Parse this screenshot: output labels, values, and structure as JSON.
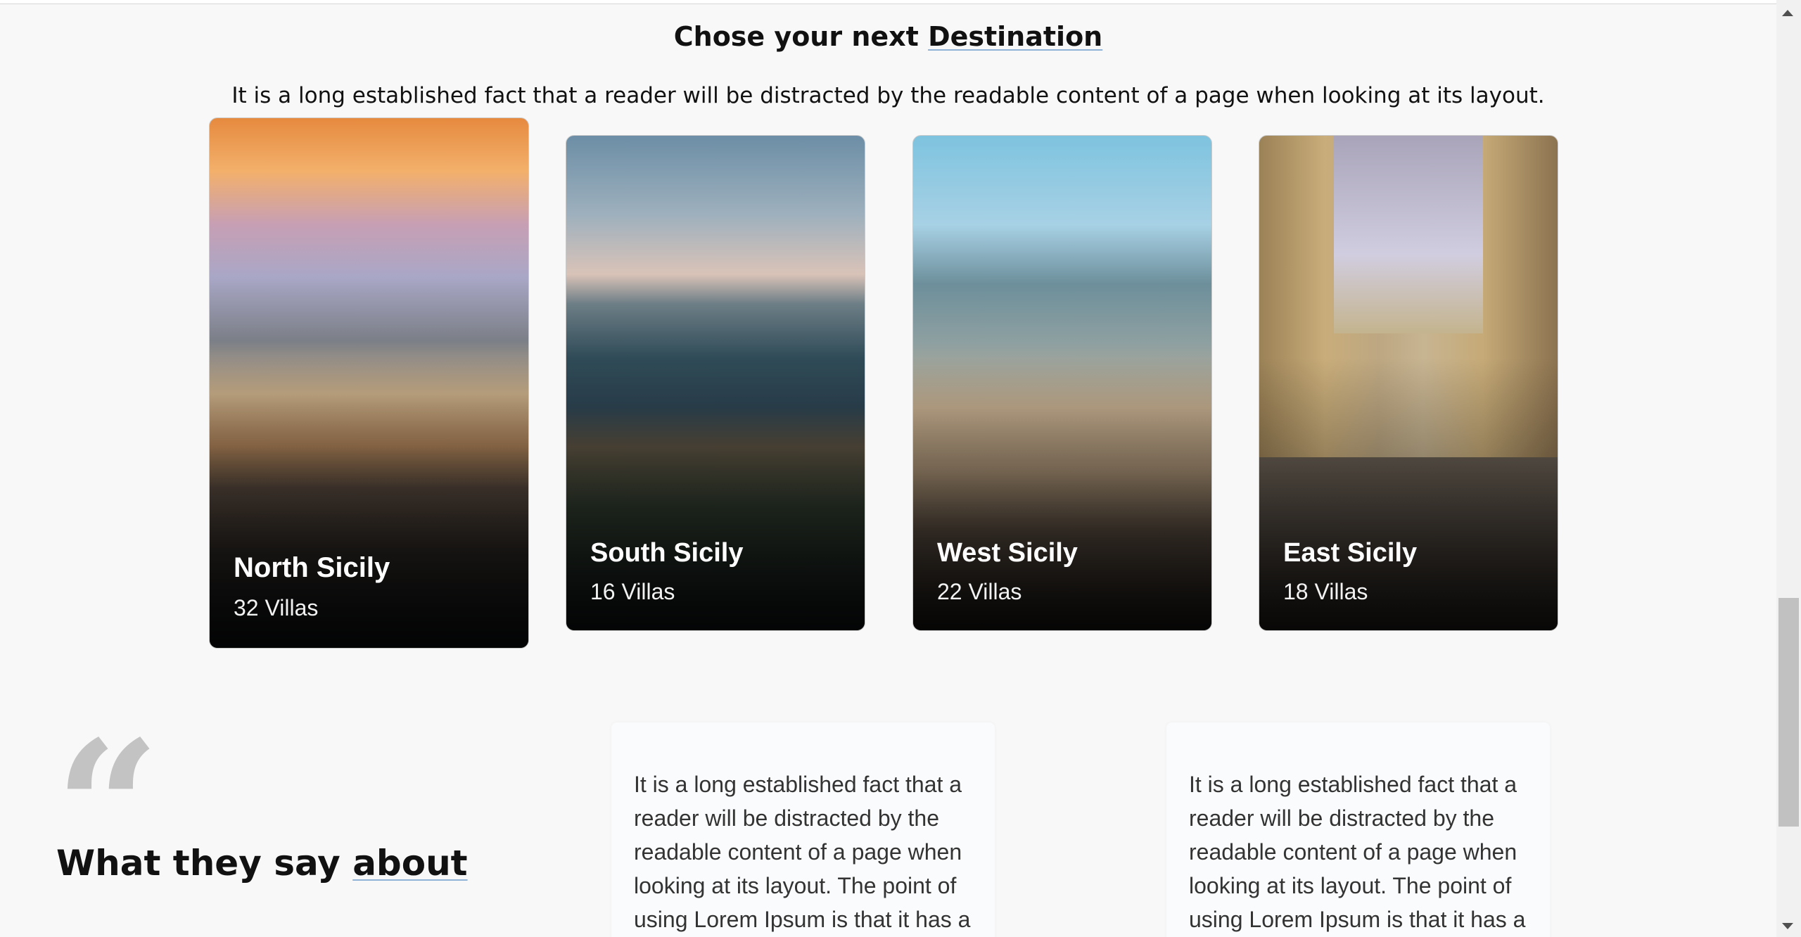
{
  "destinations": {
    "title_prefix": "Chose your next",
    "title_link": "Destination",
    "subtitle": "It is a long established fact that a reader will be distracted by the readable content of a page when looking at its layout.",
    "cards": [
      {
        "name": "North Sicily",
        "count": "32 Villas"
      },
      {
        "name": "South Sicily",
        "count": "16 Villas"
      },
      {
        "name": "West Sicily",
        "count": "22 Villas"
      },
      {
        "name": "East Sicily",
        "count": "18 Villas"
      }
    ]
  },
  "testimonials": {
    "heading_prefix": "What they say",
    "heading_link": "about",
    "quote_icon": "quote-icon",
    "items": [
      {
        "text": "It is a long established fact that a reader will be distracted by the readable content of a page when looking at its layout. The point of using Lorem Ipsum is that it has a"
      },
      {
        "text": "It is a long established fact that a reader will be distracted by the readable content of a page when looking at its layout. The point of using Lorem Ipsum is that it has a"
      }
    ]
  }
}
